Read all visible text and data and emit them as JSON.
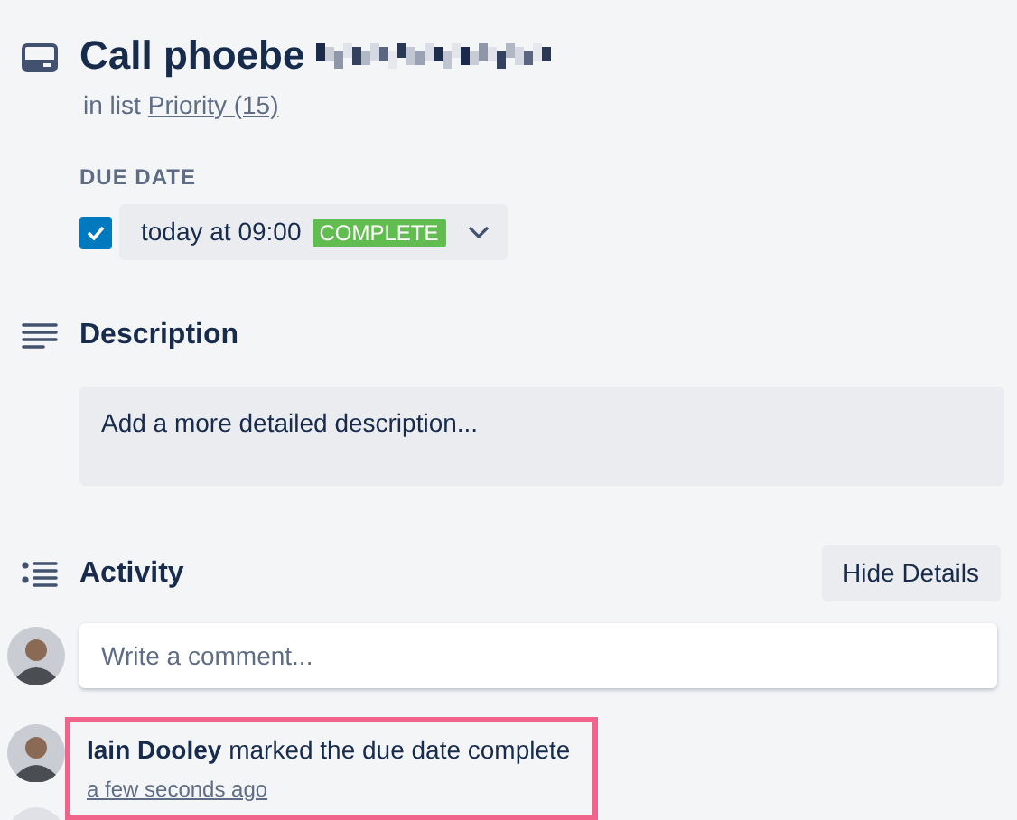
{
  "card": {
    "title": "Call phoebe",
    "title_redacted": true,
    "list_prefix": "in list",
    "list_link": "Priority (15)"
  },
  "due_date": {
    "label": "DUE DATE",
    "checked": true,
    "value": "today at 09:00",
    "badge": "COMPLETE"
  },
  "description": {
    "heading": "Description",
    "placeholder": "Add a more detailed description..."
  },
  "activity": {
    "heading": "Activity",
    "toggle_button": "Hide Details",
    "comment_placeholder": "Write a comment...",
    "entries": [
      {
        "text": "**Iain Dooley** marked the due date complete",
        "time": "a few seconds ago",
        "highlighted": true
      }
    ]
  }
}
